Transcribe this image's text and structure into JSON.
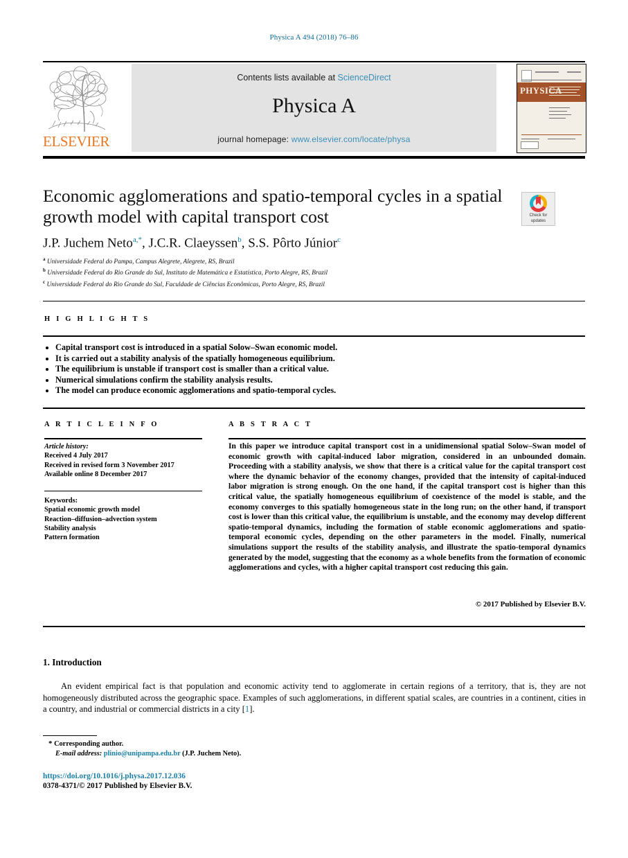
{
  "running_head": "Physica A 494 (2018) 76–86",
  "masthead": {
    "publisher_name": "ELSEVIER",
    "contents_prefix": "Contents lists available at",
    "contents_link": "ScienceDirect",
    "journal_title": "Physica A",
    "homepage_prefix": "journal homepage:",
    "homepage_link": "www.elsevier.com/locate/physa",
    "cover_title": "PHYSICA",
    "cover_subtitle": "STATISTICAL MECHANICS AND ITS APPLICATIONS"
  },
  "article": {
    "title": "Economic agglomerations and spatio-temporal cycles in a spatial growth model with capital transport cost",
    "authors_html": "J.P. Juchem Neto, J.C.R. Claeyssen, S.S. Pôrto Júnior",
    "author_list": [
      {
        "name": "J.P. Juchem Neto",
        "marks": "a,*"
      },
      {
        "name": "J.C.R. Claeyssen",
        "marks": "b"
      },
      {
        "name": "S.S. Pôrto Júnior",
        "marks": "c"
      }
    ],
    "affiliations": [
      {
        "mark": "a",
        "text": "Universidade Federal do Pampa, Campus Alegrete, Alegrete, RS, Brazil"
      },
      {
        "mark": "b",
        "text": "Universidade Federal do Rio Grande do Sul, Instituto de Matemática e Estatística, Porto Alegre, RS, Brazil"
      },
      {
        "mark": "c",
        "text": "Universidade Federal do Rio Grande do Sul, Faculdade de Ciências Econômicas, Porto Alegre, RS, Brazil"
      }
    ]
  },
  "crossmark": {
    "line1": "Check for",
    "line2": "updates"
  },
  "highlights": {
    "heading": "H I G H L I G H T S",
    "items": [
      "Capital transport cost is introduced in a spatial Solow–Swan economic model.",
      "It is carried out a stability analysis of the spatially homogeneous equilibrium.",
      "The equilibrium is unstable if transport cost is smaller than a critical value.",
      "Numerical simulations confirm the stability analysis results.",
      "The model can produce economic agglomerations and spatio-temporal cycles."
    ]
  },
  "article_info": {
    "heading": "A R T I C L E   I N F O",
    "history_label": "Article history:",
    "history": [
      "Received 4 July 2017",
      "Received in revised form 3 November 2017",
      "Available online 8 December 2017"
    ],
    "keywords_label": "Keywords:",
    "keywords": [
      "Spatial economic growth model",
      "Reaction–diffusion–advection system",
      "Stability analysis",
      "Pattern formation"
    ]
  },
  "abstract": {
    "heading": "A B S T R A C T",
    "text": "In this paper we introduce capital transport cost in a unidimensional spatial Solow–Swan model of economic growth with capital-induced labor migration, considered in an unbounded domain. Proceeding with a stability analysis, we show that there is a critical value for the capital transport cost where the dynamic behavior of the economy changes, provided that the intensity of capital-induced labor migration is strong enough. On the one hand, if the capital transport cost is higher than this critical value, the spatially homogeneous equilibrium of coexistence of the model is stable, and the economy converges to this spatially homogeneous state in the long run; on the other hand, if transport cost is lower than this critical value, the equilibrium is unstable, and the economy may develop different spatio-temporal dynamics, including the formation of stable economic agglomerations and spatio-temporal economic cycles, depending on the other parameters in the model. Finally, numerical simulations support the results of the stability analysis, and illustrate the spatio-temporal dynamics generated by the model, suggesting that the economy as a whole benefits from the formation of economic agglomerations and cycles, with a higher capital transport cost reducing this gain.",
    "copyright": "© 2017 Published by Elsevier B.V."
  },
  "introduction": {
    "heading": "1.  Introduction",
    "paragraph_before_ref": "An evident empirical fact is that population and economic activity tend to agglomerate in certain regions of a territory, that is, they are not homogeneously distributed across the geographic space. Examples of such agglomerations, in different spatial scales, are countries in a continent, cities in a country, and industrial or commercial districts in a city [",
    "reference_number": "1",
    "paragraph_after_ref": "]."
  },
  "footnote": {
    "corresponding": "Corresponding author.",
    "email_label": "E-mail address:",
    "email": "plinio@unipampa.edu.br",
    "email_owner": "(J.P. Juchem Neto).",
    "doi": "https://doi.org/10.1016/j.physa.2017.12.036",
    "issn": "0378-4371/© 2017 Published by Elsevier B.V."
  },
  "colors": {
    "link_blue": "#1b7fa8",
    "sciencedirect_blue": "#3a8fb7",
    "elsevier_orange": "#e87722",
    "band_gray": "#e3e3e3"
  }
}
